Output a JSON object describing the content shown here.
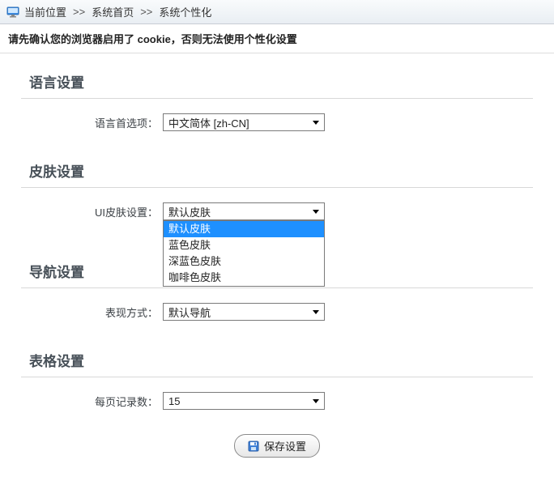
{
  "breadcrumb": {
    "label_current": "当前位置",
    "sep": ">>",
    "home": "系统首页",
    "current": "系统个性化"
  },
  "notice": "请先确认您的浏览器启用了 cookie，否则无法使用个性化设置",
  "sections": {
    "language": {
      "title": "语言设置",
      "field_label": "语言首选项：",
      "selected": "中文简体 [zh-CN]"
    },
    "skin": {
      "title": "皮肤设置",
      "field_label": "UI皮肤设置：",
      "selected": "默认皮肤",
      "options": [
        "默认皮肤",
        "蓝色皮肤",
        "深蓝色皮肤",
        "咖啡色皮肤"
      ]
    },
    "nav": {
      "title": "导航设置",
      "field_label": "表现方式：",
      "selected": "默认导航"
    },
    "table": {
      "title": "表格设置",
      "field_label": "每页记录数：",
      "selected": "15"
    }
  },
  "save_button": "保存设置"
}
